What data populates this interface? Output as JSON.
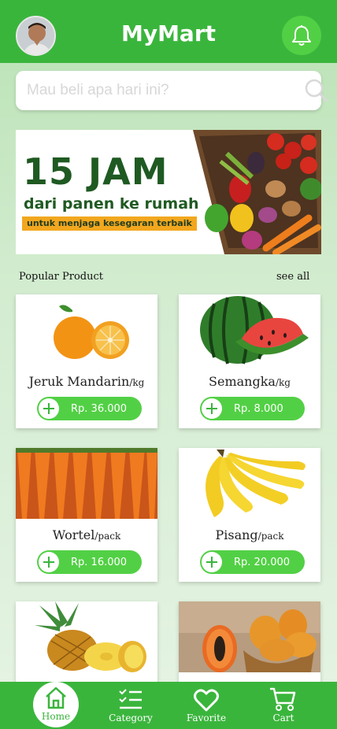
{
  "header": {
    "title": "MyMart",
    "avatar_icon": "user-avatar",
    "notification_icon": "bell-icon"
  },
  "search": {
    "placeholder": "Mau beli apa hari ini?",
    "value": ""
  },
  "banner": {
    "headline": "15 JAM",
    "subline": "dari panen ke rumah",
    "tagline": "untuk menjaga kesegaran terbaik"
  },
  "popular": {
    "title": "Popular Product",
    "see_all": "see all",
    "products": [
      {
        "name": "Jeruk Mandarin",
        "unit": "/kg",
        "price": "Rp. 36.000",
        "image": "orange"
      },
      {
        "name": "Semangka",
        "unit": "/kg",
        "price": "Rp. 8.000",
        "image": "watermelon"
      },
      {
        "name": "Wortel",
        "unit": "/pack",
        "price": "Rp. 16.000",
        "image": "carrot"
      },
      {
        "name": "Pisang",
        "unit": "/pack",
        "price": "Rp. 20.000",
        "image": "banana"
      },
      {
        "name": "",
        "unit": "",
        "price": "",
        "image": "pineapple"
      },
      {
        "name": "",
        "unit": "",
        "price": "",
        "image": "papaya"
      }
    ]
  },
  "bottom_nav": {
    "items": [
      {
        "label": "Home",
        "icon": "home-icon",
        "active": true
      },
      {
        "label": "Category",
        "icon": "list-icon",
        "active": false
      },
      {
        "label": "Favorite",
        "icon": "heart-icon",
        "active": false
      },
      {
        "label": "Cart",
        "icon": "cart-icon",
        "active": false
      }
    ]
  },
  "colors": {
    "primary": "#3ab53c",
    "accent": "#52d045",
    "banner_text": "#1f5a22",
    "banner_tag": "#f2a71e"
  }
}
